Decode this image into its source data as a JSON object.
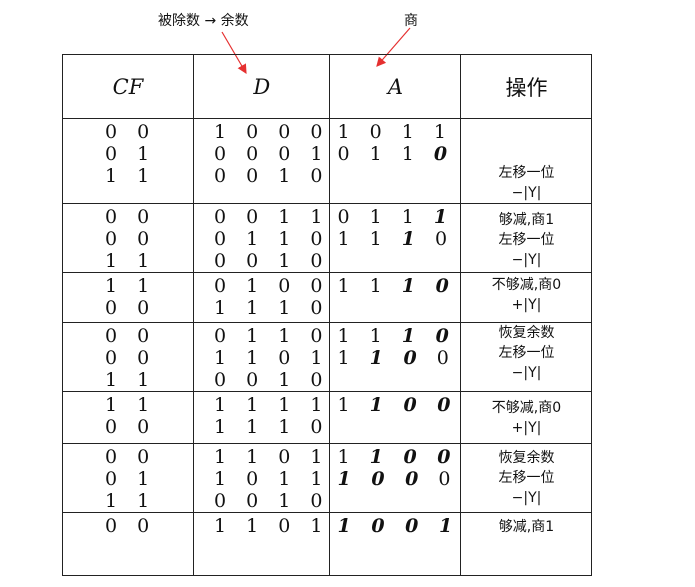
{
  "annotations": {
    "dividend_remainder": "被除数 → 余数",
    "quotient": "商"
  },
  "headers": {
    "cf": "CF",
    "d": "D",
    "a": "A",
    "op": "操作"
  },
  "rows": [
    {
      "cf": [
        "0 0",
        "0 1",
        "1 1"
      ],
      "d": [
        "1 0 0 0",
        "0 0 0 1",
        "0 0 1 0"
      ],
      "a": [
        [
          "1 0 1 1",
          ""
        ],
        [
          "0 1 1 ",
          "0"
        ],
        [
          "",
          ""
        ]
      ],
      "op": [
        "",
        "左移一位",
        "−|Y|"
      ]
    },
    {
      "cf": [
        "0 0",
        "0 0",
        "1 1"
      ],
      "d": [
        "0 0 1 1",
        "0 1 1 0",
        "0 0 1 0"
      ],
      "a": [
        [
          "0 1 1 ",
          "1"
        ],
        [
          "1 1 ",
          "1",
          " 0"
        ],
        [
          "",
          ""
        ]
      ],
      "op": [
        "够减,商1",
        "左移一位",
        "−|Y|"
      ]
    },
    {
      "cf": [
        "1 1",
        "0 0"
      ],
      "d": [
        "0 1 0 0",
        "1 1 1 0"
      ],
      "a": [
        [
          "1 1 ",
          "1 0"
        ],
        [
          "",
          ""
        ]
      ],
      "op": [
        "不够减,商0",
        "+|Y|"
      ]
    },
    {
      "cf": [
        "0 0",
        "0 0",
        "1 1"
      ],
      "d": [
        "0 1 1 0",
        "1 1 0 1",
        "0 0 1 0"
      ],
      "a": [
        [
          "1 1 ",
          "1 0"
        ],
        [
          "1 ",
          "1 0",
          " 0"
        ],
        [
          "",
          ""
        ]
      ],
      "op": [
        "恢复余数",
        "左移一位",
        "−|Y|"
      ]
    },
    {
      "cf": [
        "1 1",
        "0 0"
      ],
      "d": [
        "1 1 1 1",
        "1 1 1 0"
      ],
      "a": [
        [
          "1 ",
          "1 0 0"
        ],
        [
          "",
          ""
        ]
      ],
      "op": [
        "不够减,商0",
        "+|Y|"
      ]
    },
    {
      "cf": [
        "0 0",
        "0 1",
        "1 1"
      ],
      "d": [
        "1 1 0 1",
        "1 0 1 1",
        "0 0 1 0"
      ],
      "a": [
        [
          "1 ",
          "1 0 0"
        ],
        [
          "",
          "1 0 0",
          " 0"
        ],
        [
          "",
          ""
        ]
      ],
      "op": [
        "恢复余数",
        "左移一位",
        "−|Y|"
      ]
    },
    {
      "cf": [
        "0 0"
      ],
      "d": [
        "1 1 0 1"
      ],
      "a": [
        [
          "",
          "1 0 0 1"
        ]
      ],
      "op": [
        "够减,商1"
      ]
    }
  ]
}
